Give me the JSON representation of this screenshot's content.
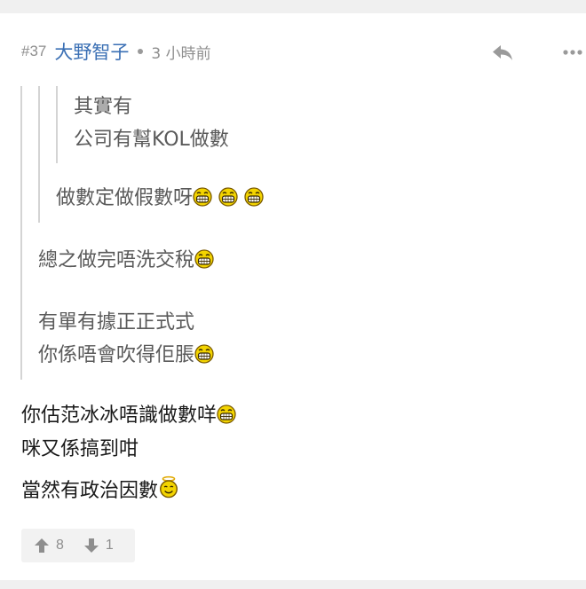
{
  "post": {
    "number": "#37",
    "username": "大野智子",
    "time": "3 小時前",
    "quotes": {
      "level3": [
        "其實有",
        "公司有幫KOL做數"
      ],
      "level2": [
        "做數定做假數呀"
      ],
      "level1": [
        "總之做完唔洗交稅",
        "有單有據正正式式",
        "你係唔會吹得佢脹"
      ]
    },
    "body": [
      "你估范冰冰唔識做數咩",
      "咪又係搞到咁",
      "當然有政治因數"
    ],
    "votes": {
      "up": "8",
      "down": "1"
    }
  },
  "icons": {
    "reply": "reply-arrow-icon",
    "more": "more-dots-icon",
    "upvote": "thumbs-up-arrow-icon",
    "downvote": "thumbs-down-arrow-icon",
    "emoji_grin": "grin-emoji-icon",
    "emoji_angel": "angel-emoji-icon"
  },
  "colors": {
    "username": "#3a6fb4",
    "muted": "#8e8e8e",
    "quote_bar": "#d4d4d4",
    "emoji_yellow": "#f3d400"
  }
}
